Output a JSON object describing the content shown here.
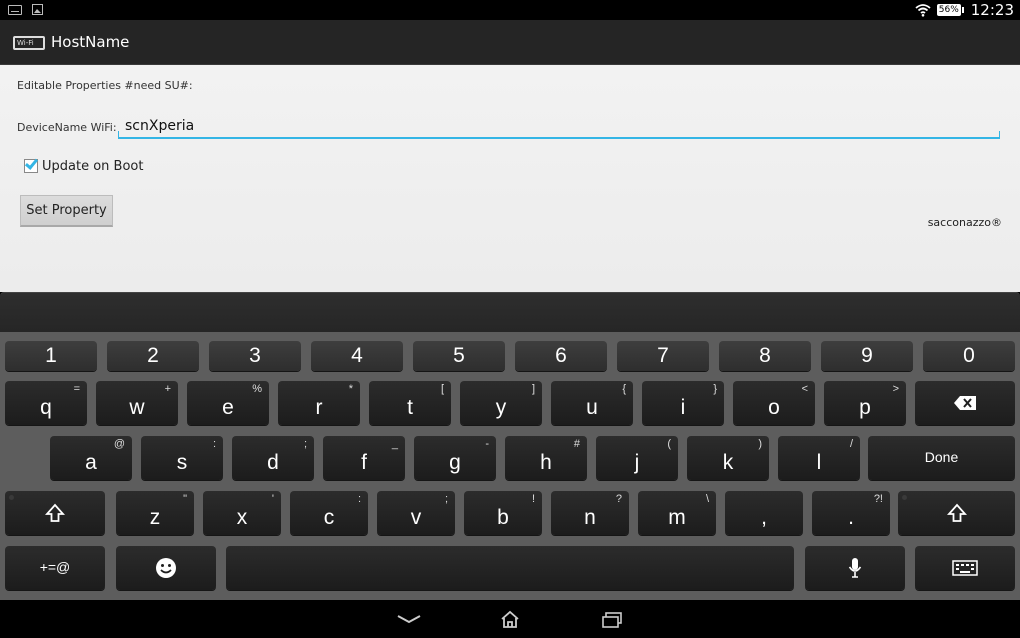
{
  "status_bar": {
    "battery": "56%",
    "time": "12:23"
  },
  "app": {
    "title": "HostName",
    "icon_text": "Wi-Fi"
  },
  "form": {
    "editable_label": "Editable Properties #need SU#:",
    "device_label": "DeviceName WiFi:",
    "device_value": "scnXperia",
    "update_on_boot_label": "Update on Boot",
    "update_on_boot_checked": true,
    "set_button": "Set Property",
    "credit": "sacconazzo®"
  },
  "keyboard": {
    "numbers": [
      "1",
      "2",
      "3",
      "4",
      "5",
      "6",
      "7",
      "8",
      "9",
      "0"
    ],
    "row1": [
      {
        "k": "q",
        "s": "="
      },
      {
        "k": "w",
        "s": "+"
      },
      {
        "k": "e",
        "s": "%"
      },
      {
        "k": "r",
        "s": "*"
      },
      {
        "k": "t",
        "s": "["
      },
      {
        "k": "y",
        "s": "]"
      },
      {
        "k": "u",
        "s": "{"
      },
      {
        "k": "i",
        "s": "}"
      },
      {
        "k": "o",
        "s": "<"
      },
      {
        "k": "p",
        "s": ">"
      }
    ],
    "row2": [
      {
        "k": "a",
        "s": "@"
      },
      {
        "k": "s",
        "s": ":"
      },
      {
        "k": "d",
        "s": ";"
      },
      {
        "k": "f",
        "s": "_"
      },
      {
        "k": "g",
        "s": "-"
      },
      {
        "k": "h",
        "s": "#"
      },
      {
        "k": "j",
        "s": "("
      },
      {
        "k": "k",
        "s": ")"
      },
      {
        "k": "l",
        "s": "/"
      }
    ],
    "done": "Done",
    "row3": [
      {
        "k": "z",
        "s": "\""
      },
      {
        "k": "x",
        "s": "'"
      },
      {
        "k": "c",
        "s": ":"
      },
      {
        "k": "v",
        "s": ";"
      },
      {
        "k": "b",
        "s": "!"
      },
      {
        "k": "n",
        "s": "?"
      },
      {
        "k": "m",
        "s": "\\"
      },
      {
        "k": ",",
        "s": ""
      },
      {
        "k": ".",
        "s": "?!"
      }
    ],
    "symbols": "+=@"
  },
  "icons": {
    "backspace": "backspace-icon",
    "shift": "shift-icon",
    "emoji": "emoji-icon",
    "mic": "microphone-icon",
    "keyboard_hide": "keyboard-icon"
  }
}
